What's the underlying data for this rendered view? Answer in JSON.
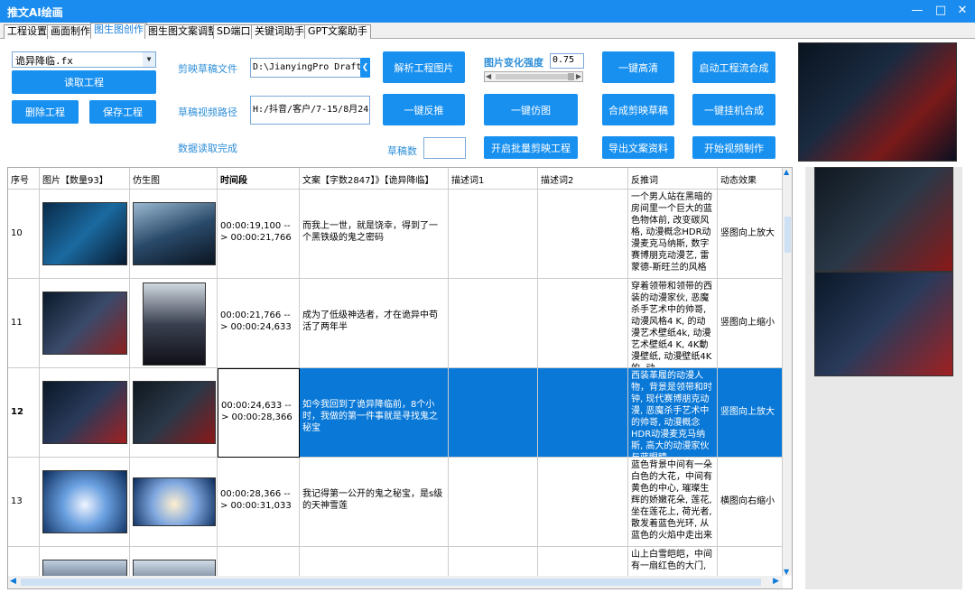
{
  "window": {
    "title": "推文AI绘画"
  },
  "tabs": [
    "工程设置",
    "画面制作",
    "图生图创作",
    "图生图文案调整",
    "SD端口",
    "关键词助手",
    "GPT文案助手"
  ],
  "left": {
    "combo_value": "诡异降临.fx",
    "read_btn": "读取工程",
    "delete_btn": "删除工程",
    "save_btn": "保存工程"
  },
  "form": {
    "draft_label": "剪映草稿文件",
    "draft_path": "D:\\JianyingPro Drafts\\诡",
    "video_label": "草稿视频路径",
    "video_path": "H:/抖音/客户/7-15/8月24日.",
    "status": "数据读取完成",
    "drafts_label": "草稿数",
    "drafts_value": ""
  },
  "buttons": {
    "parse": "解析工程图片",
    "reverse": "一键反推",
    "imitate": "一键仿图",
    "strength_label": "图片变化强度",
    "strength_value": "0.75",
    "hd": "一键高清",
    "compose_draft": "合成剪映草稿",
    "export_text": "导出文案资料",
    "start_flow": "启动工程流合成",
    "hang_compose": "一键挂机合成",
    "start_video": "开始视频制作",
    "batch": "开启批量剪映工程"
  },
  "table": {
    "headers": [
      "序号",
      "图片【数量93】",
      "仿生图",
      "时间段",
      "文案【字数2847】》【诡异降临】",
      "描述词1",
      "描述词2",
      "反推词",
      "动态效果"
    ],
    "rows": [
      {
        "no": "10",
        "time": "00:00:19,100 --> 00:00:21,766",
        "text": "而我上一世，就是饶幸，得到了一个黑铁级的鬼之密码",
        "rev": "一个男人站在黑暗的房间里一个巨大的蓝色物体前, 改变碳风格, 动漫概念HDR动漫麦克马纳斯, 数字赛博朋克动漫艺, 雷蒙德-斯旺兰的风格",
        "effect": "竖图向上放大"
      },
      {
        "no": "11",
        "time": "00:00:21,766 --> 00:00:24,633",
        "text": "成为了低级神选者，才在诡异中苟活了两年半",
        "rev": "穿着领带和领带的西装的动漫家伙, 恶魔杀手艺术中的帅哥, 动漫风格4 K, 的动漫艺术壁纸4k, 动漫艺术壁纸4 K, 4K動漫壁纸, 动漫壁纸4K的, 动",
        "effect": "竖图向上缩小"
      },
      {
        "no": "12",
        "time": "00:00:24,633 --> 00:00:28,366",
        "text": "如今我回到了诡异降临前，8个小时，我做的第一件事就是寻找鬼之秘宝",
        "rev": "西装革履的动漫人物，背景是领带和时钟, 现代赛博朋克动漫, 恶魔杀手艺术中的帅哥, 动漫概念HDR动漫麦克马纳斯, 高大的动漫家伙与蓝眼睛",
        "effect": "竖图向上放大"
      },
      {
        "no": "13",
        "time": "00:00:28,366 --> 00:00:31,033",
        "text": "我记得第一公开的鬼之秘宝，是s级的天神雪莲",
        "rev": "蓝色背景中间有一朵白色的大花，中间有黄色的中心, 璀璨生辉的娇嫩花朵, 莲花, 坐在莲花上, 荷光者, 散发着蓝色光环, 从蓝色的火焰中走出来",
        "effect": "横图向右缩小"
      },
      {
        "no": "",
        "time": "",
        "text": "",
        "rev": "山上白雪皑皑，中间有一扇红色的大门,",
        "effect": ""
      }
    ]
  }
}
